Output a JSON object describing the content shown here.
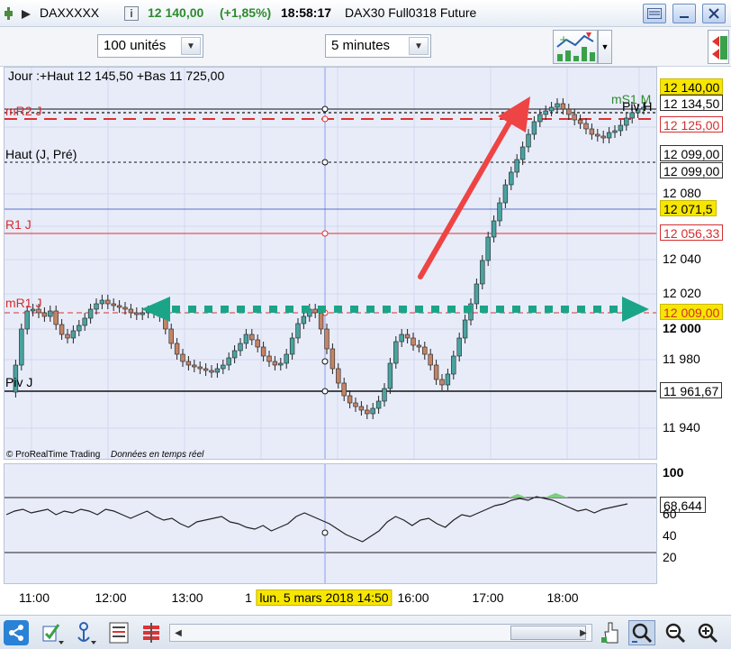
{
  "window": {
    "symbol": "DAXXXXX",
    "price": "12 140,00",
    "change": "(+1,85%)",
    "time": "18:58:17",
    "instrument": "DAX30 Full0318 Future"
  },
  "toolbar": {
    "units_value": "100 unités",
    "interval_value": "5 minutes"
  },
  "chart": {
    "header_text": "Jour :+Haut 12 145,50 +Bas 11 725,00",
    "level_labels": {
      "mr2": "mR2 J",
      "haut": "Haut (J, Pré)",
      "r1": "R1 J",
      "mr1": "mR1 J",
      "piv": "Piv J",
      "ms1": "mS1 M",
      "pivh": "Piv H"
    },
    "watermark_brand": "© ProRealTime Trading",
    "watermark_note": "Données en temps réel"
  },
  "price_axis": {
    "ticks": [
      "12 080",
      "12 040",
      "12 020",
      "12 000",
      "11 980",
      "11 940"
    ],
    "labels": {
      "last": "12 140,00",
      "l1": "12 134,50",
      "l2": "12 125,00",
      "l3": "12 099,00",
      "l4": "12 099,00",
      "l5": "12 071,5",
      "l6": "12 056,33",
      "l7": "12 009,00",
      "l8": "11 961,67"
    }
  },
  "osc_axis": {
    "ticks": [
      "100",
      "60",
      "40",
      "20"
    ],
    "value_label": "68,644"
  },
  "time_axis": {
    "ticks": [
      "11:00",
      "12:00",
      "13:00",
      "16:00",
      "17:00",
      "18:00"
    ],
    "cursor_label": "lun. 5 mars 2018 14:50",
    "cursor_prefix": "1"
  },
  "colors": {
    "bull": "#4aa3a0",
    "bear": "#c38467",
    "red_line": "#e03030",
    "arrow_red": "#ee4444",
    "arrow_teal": "#1aa588",
    "chart_bg": "#e8ecf9",
    "cursor_line": "#8c9ce6"
  }
}
